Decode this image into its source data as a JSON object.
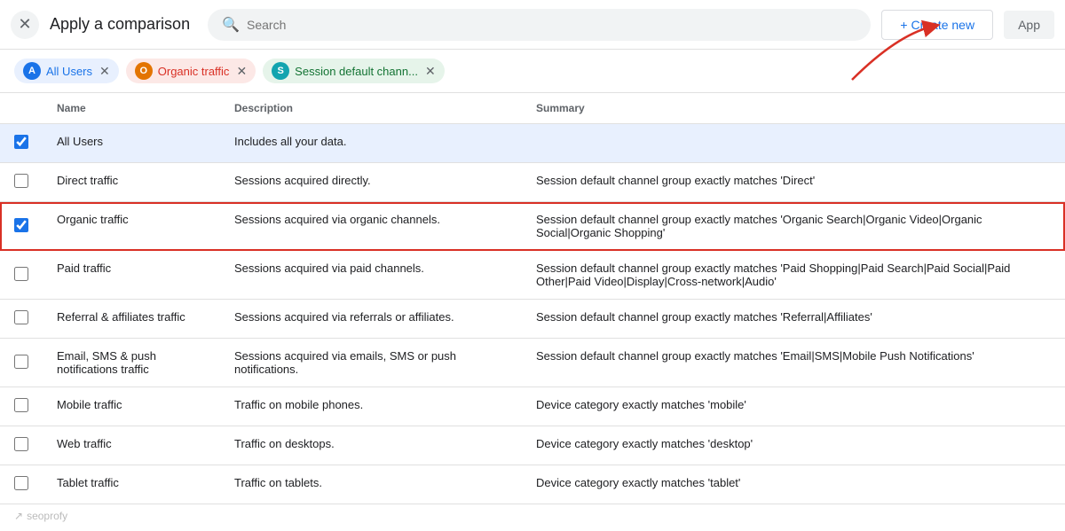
{
  "header": {
    "title": "Apply a comparison",
    "search_placeholder": "Search",
    "create_new_label": "+ Create new",
    "apply_label": "App"
  },
  "tags": [
    {
      "id": "all-users",
      "label": "All Users",
      "avatar_letter": "A",
      "color_class": "tag-blue",
      "avatar_color": "#1a73e8"
    },
    {
      "id": "organic-traffic",
      "label": "Organic traffic",
      "avatar_letter": "O",
      "color_class": "tag-orange",
      "avatar_color": "#e37400"
    },
    {
      "id": "session-default",
      "label": "Session default chann...",
      "avatar_letter": "S",
      "color_class": "tag-teal",
      "avatar_color": "#12a4af"
    }
  ],
  "table": {
    "columns": [
      "Name",
      "Description",
      "Summary"
    ],
    "rows": [
      {
        "id": "all-users",
        "name": "All Users",
        "description": "Includes all your data.",
        "summary": "",
        "checked": true,
        "selected": true,
        "highlighted": false
      },
      {
        "id": "direct-traffic",
        "name": "Direct traffic",
        "description": "Sessions acquired directly.",
        "summary": "Session default channel group exactly matches 'Direct'",
        "checked": false,
        "selected": false,
        "highlighted": false
      },
      {
        "id": "organic-traffic",
        "name": "Organic traffic",
        "description": "Sessions acquired via organic channels.",
        "summary": "Session default channel group exactly matches 'Organic Search|Organic Video|Organic Social|Organic Shopping'",
        "checked": true,
        "selected": false,
        "highlighted": true
      },
      {
        "id": "paid-traffic",
        "name": "Paid traffic",
        "description": "Sessions acquired via paid channels.",
        "summary": "Session default channel group exactly matches 'Paid Shopping|Paid Search|Paid Social|Paid Other|Paid Video|Display|Cross-network|Audio'",
        "checked": false,
        "selected": false,
        "highlighted": false
      },
      {
        "id": "referral-affiliates",
        "name": "Referral & affiliates traffic",
        "description": "Sessions acquired via referrals or affiliates.",
        "summary": "Session default channel group exactly matches 'Referral|Affiliates'",
        "checked": false,
        "selected": false,
        "highlighted": false
      },
      {
        "id": "email-sms",
        "name": "Email, SMS & push notifications traffic",
        "description": "Sessions acquired via emails, SMS or push notifications.",
        "summary": "Session default channel group exactly matches 'Email|SMS|Mobile Push Notifications'",
        "checked": false,
        "selected": false,
        "highlighted": false
      },
      {
        "id": "mobile-traffic",
        "name": "Mobile traffic",
        "description": "Traffic on mobile phones.",
        "summary": "Device category exactly matches 'mobile'",
        "checked": false,
        "selected": false,
        "highlighted": false
      },
      {
        "id": "web-traffic",
        "name": "Web traffic",
        "description": "Traffic on desktops.",
        "summary": "Device category exactly matches 'desktop'",
        "checked": false,
        "selected": false,
        "highlighted": false
      },
      {
        "id": "tablet-traffic",
        "name": "Tablet traffic",
        "description": "Traffic on tablets.",
        "summary": "Device category exactly matches 'tablet'",
        "checked": false,
        "selected": false,
        "highlighted": false
      }
    ]
  },
  "watermark": {
    "icon": "↗",
    "text": "seoprofy"
  }
}
